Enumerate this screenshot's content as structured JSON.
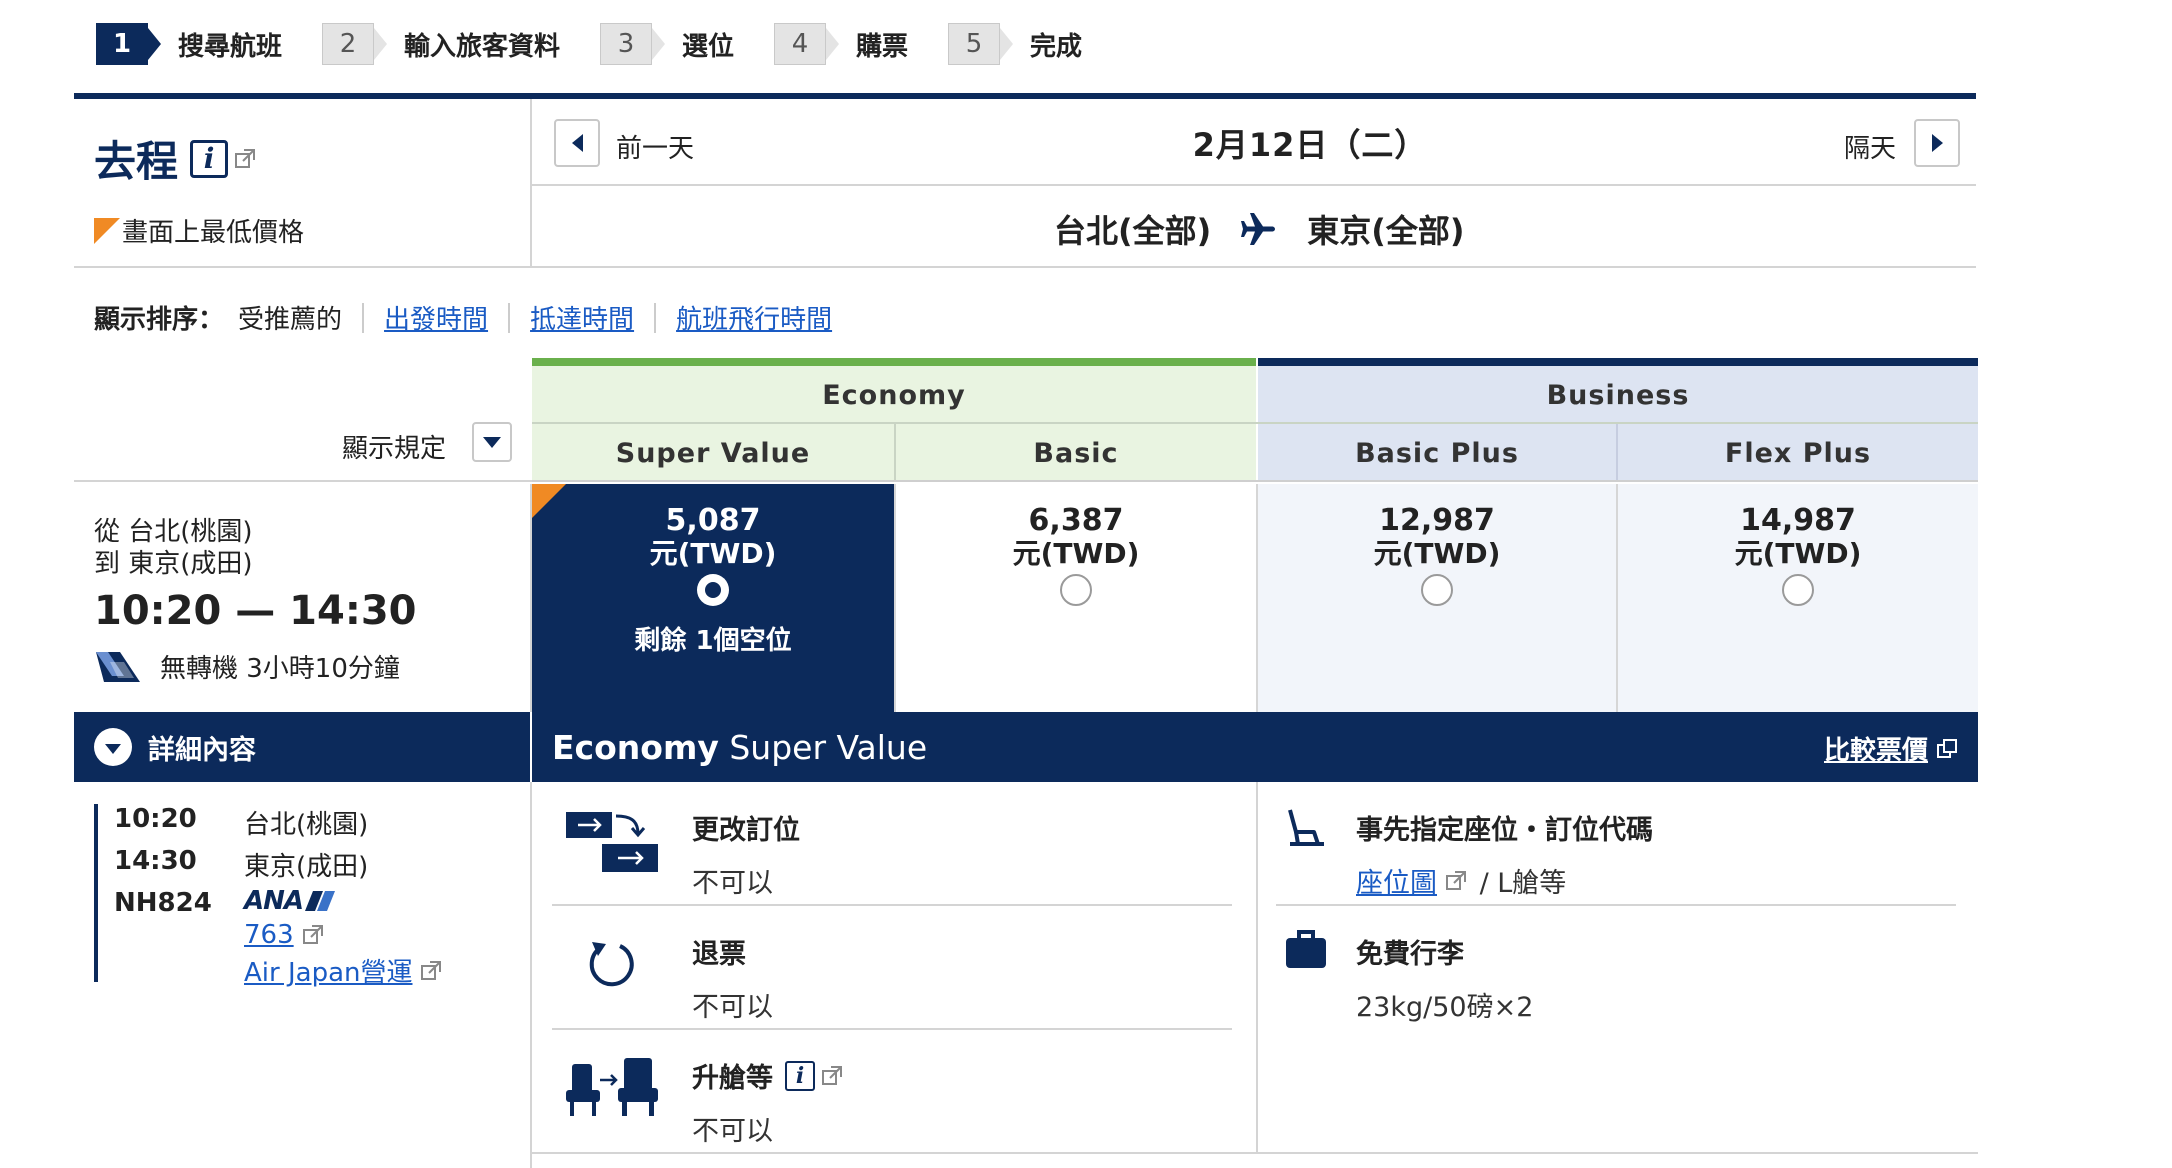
{
  "steps": [
    {
      "num": "1",
      "label": "搜尋航班",
      "active": true
    },
    {
      "num": "2",
      "label": "輸入旅客資料",
      "active": false
    },
    {
      "num": "3",
      "label": "選位",
      "active": false
    },
    {
      "num": "4",
      "label": "購票",
      "active": false
    },
    {
      "num": "5",
      "label": "完成",
      "active": false
    }
  ],
  "outbound": {
    "title": "去程",
    "lowest_price_label": "畫面上最低價格"
  },
  "date_nav": {
    "prev_label": "前一天",
    "date": "2月12日（二）",
    "next_label": "隔天"
  },
  "route": {
    "from": "台北(全部)",
    "to": "東京(全部)"
  },
  "sort": {
    "label": "顯示排序：",
    "current": "受推薦的",
    "options": [
      "出發時間",
      "抵達時間",
      "航班飛行時間"
    ]
  },
  "rules_label": "顯示規定",
  "cabins": {
    "economy": "Economy",
    "business": "Business"
  },
  "fare_types": [
    "Super Value",
    "Basic",
    "Basic Plus",
    "Flex Plus"
  ],
  "fares": [
    {
      "price": "5,087",
      "currency": "元(TWD)",
      "seats": "剩餘 1個空位",
      "selected": true
    },
    {
      "price": "6,387",
      "currency": "元(TWD)",
      "seats": "",
      "selected": false
    },
    {
      "price": "12,987",
      "currency": "元(TWD)",
      "seats": "",
      "selected": false
    },
    {
      "price": "14,987",
      "currency": "元(TWD)",
      "seats": "",
      "selected": false
    }
  ],
  "flight": {
    "from": "從 台北(桃園)",
    "to": "到 東京(成田)",
    "time": "10:20 — 14:30",
    "stops": "無轉機 3小時10分鐘",
    "details_label": "詳細內容",
    "segment": {
      "dep_time": "10:20",
      "dep_airport": "台北(桃園)",
      "arr_time": "14:30",
      "arr_airport": "東京(成田)",
      "flight_no": "NH824",
      "airline_logo": "ANA",
      "aircraft": "763",
      "operator": "Air Japan營運"
    }
  },
  "fare_detail": {
    "title_bold": "Economy",
    "title_rest": " Super Value",
    "compare_label": "比較票價",
    "change": {
      "title": "更改訂位",
      "value": "不可以"
    },
    "refund": {
      "title": "退票",
      "value": "不可以"
    },
    "upgrade": {
      "title": "升艙等",
      "value": "不可以"
    },
    "seat": {
      "title": "事先指定座位・訂位代碼",
      "link": "座位圖",
      "value": " / L艙等"
    },
    "baggage": {
      "title": "免費行李",
      "value": "23kg/50磅×2"
    }
  },
  "colors": {
    "navy": "#0c2a5b",
    "economy_green": "#6ab04c",
    "economy_bg": "#e9f4e1",
    "business_bg": "#dde4f2",
    "lowest_orange": "#f08a24",
    "link": "#1a5bc4"
  }
}
